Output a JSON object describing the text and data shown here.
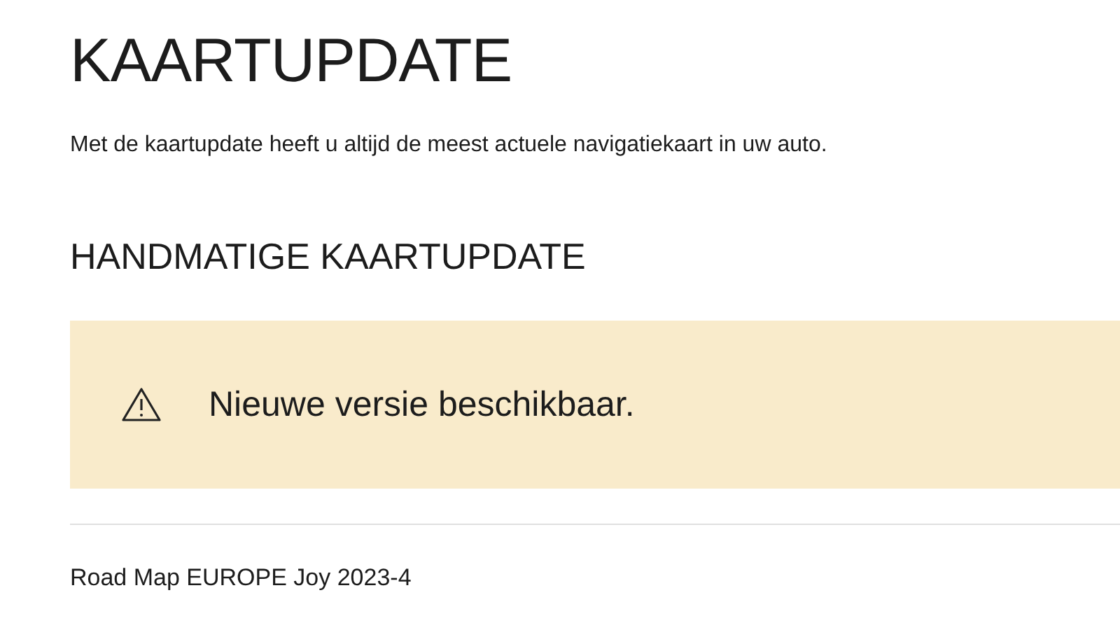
{
  "page": {
    "title": "KAARTUPDATE",
    "description": "Met de kaartupdate heeft u altijd de meest actuele navigatiekaart in uw auto."
  },
  "section": {
    "title": "HANDMATIGE KAARTUPDATE"
  },
  "alert": {
    "kind": "warning",
    "message": "Nieuwe versie beschikbaar."
  },
  "map_version": "Road Map EUROPE Joy 2023-4"
}
